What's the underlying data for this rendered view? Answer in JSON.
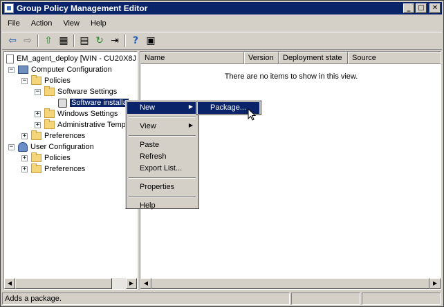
{
  "window": {
    "title": "Group Policy Management Editor",
    "buttons": {
      "minimize": "_",
      "maximize": "□",
      "close": "✕"
    }
  },
  "menu": [
    "File",
    "Action",
    "View",
    "Help"
  ],
  "toolbar": [
    "back-icon",
    "forward-icon",
    "up-folder-icon",
    "show-hide-tree-icon",
    "properties-icon",
    "refresh-icon",
    "export-list-icon",
    "help-icon",
    "toggle-pane-icon"
  ],
  "tree": {
    "root": "EM_agent_deploy [WIN - CU20X8J",
    "computer_config": "Computer Configuration",
    "policies": "Policies",
    "software_settings": "Software Settings",
    "software_install": "Software installa",
    "windows_settings": "Windows Settings",
    "admin_templates": "Administrative Temp",
    "preferences": "Preferences",
    "user_config": "User Configuration",
    "user_policies": "Policies",
    "user_preferences": "Preferences"
  },
  "list": {
    "columns": [
      "Name",
      "Version",
      "Deployment state",
      "Source"
    ],
    "empty_text": "There are no items to show in this view."
  },
  "context_menu": {
    "items": [
      "New",
      "View",
      "Paste",
      "Refresh",
      "Export List...",
      "Properties",
      "Help"
    ],
    "submenu": {
      "package": "Package..."
    }
  },
  "status": {
    "text": "Adds a package."
  },
  "colors": {
    "title_bg": "#0a246a",
    "face": "#d4d0c8",
    "highlight": "#0a246a"
  }
}
